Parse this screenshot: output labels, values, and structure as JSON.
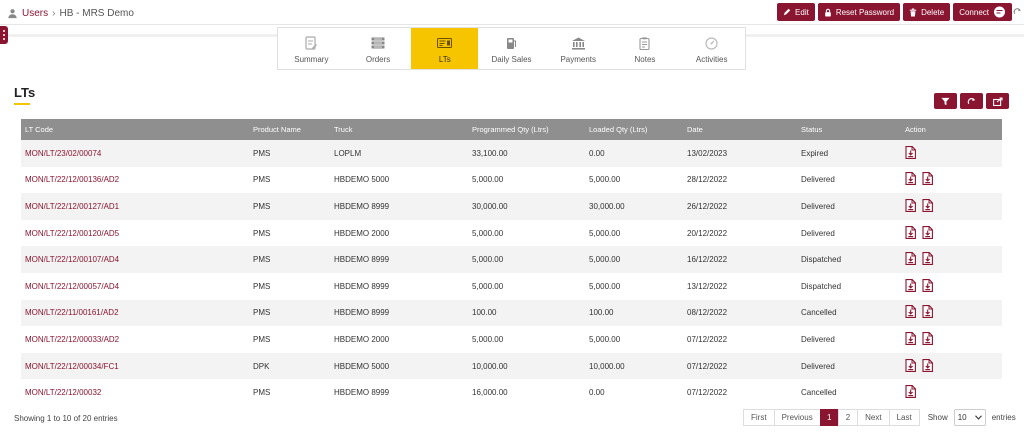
{
  "breadcrumb": {
    "root": "Users",
    "current": "HB - MRS Demo"
  },
  "top_actions": [
    {
      "label": "Edit",
      "icon": "pencil-icon"
    },
    {
      "label": "Reset Password",
      "icon": "lock-icon"
    },
    {
      "label": "Delete",
      "icon": "trash-icon"
    },
    {
      "label": "Connect",
      "icon": "chat-icon"
    }
  ],
  "tabs": [
    {
      "label": "Summary",
      "icon": "summary-icon",
      "active": false
    },
    {
      "label": "Orders",
      "icon": "orders-icon",
      "active": false
    },
    {
      "label": "LTs",
      "icon": "truck-card-icon",
      "active": true
    },
    {
      "label": "Daily Sales",
      "icon": "fuel-pump-icon",
      "active": false
    },
    {
      "label": "Payments",
      "icon": "bank-icon",
      "active": false
    },
    {
      "label": "Notes",
      "icon": "notes-icon",
      "active": false
    },
    {
      "label": "Activities",
      "icon": "dashboard-icon",
      "active": false
    }
  ],
  "section": {
    "title": "LTs"
  },
  "table": {
    "columns": [
      "LT Code",
      "Product Name",
      "Truck",
      "Programmed Qty (Ltrs)",
      "Loaded Qty (Ltrs)",
      "Date",
      "Status",
      "Action"
    ],
    "rows": [
      {
        "code": "MON/LT/23/02/00074",
        "product": "PMS",
        "truck": "LOPLM",
        "programmed": "33,100.00",
        "loaded": "0.00",
        "date": "13/02/2023",
        "status": "Expired",
        "actions": 1
      },
      {
        "code": "MON/LT/22/12/00136/AD2",
        "product": "PMS",
        "truck": "HBDEMO 5000",
        "programmed": "5,000.00",
        "loaded": "5,000.00",
        "date": "28/12/2022",
        "status": "Delivered",
        "actions": 2
      },
      {
        "code": "MON/LT/22/12/00127/AD1",
        "product": "PMS",
        "truck": "HBDEMO 8999",
        "programmed": "30,000.00",
        "loaded": "30,000.00",
        "date": "26/12/2022",
        "status": "Delivered",
        "actions": 2
      },
      {
        "code": "MON/LT/22/12/00120/AD5",
        "product": "PMS",
        "truck": "HBDEMO 2000",
        "programmed": "5,000.00",
        "loaded": "5,000.00",
        "date": "20/12/2022",
        "status": "Delivered",
        "actions": 2
      },
      {
        "code": "MON/LT/22/12/00107/AD4",
        "product": "PMS",
        "truck": "HBDEMO 8999",
        "programmed": "5,000.00",
        "loaded": "5,000.00",
        "date": "16/12/2022",
        "status": "Dispatched",
        "actions": 2
      },
      {
        "code": "MON/LT/22/12/00057/AD4",
        "product": "PMS",
        "truck": "HBDEMO 8999",
        "programmed": "5,000.00",
        "loaded": "5,000.00",
        "date": "13/12/2022",
        "status": "Dispatched",
        "actions": 2
      },
      {
        "code": "MON/LT/22/11/00161/AD2",
        "product": "PMS",
        "truck": "HBDEMO 8999",
        "programmed": "100.00",
        "loaded": "100.00",
        "date": "08/12/2022",
        "status": "Cancelled",
        "actions": 2
      },
      {
        "code": "MON/LT/22/12/00033/AD2",
        "product": "PMS",
        "truck": "HBDEMO 2000",
        "programmed": "5,000.00",
        "loaded": "5,000.00",
        "date": "07/12/2022",
        "status": "Delivered",
        "actions": 2
      },
      {
        "code": "MON/LT/22/12/00034/FC1",
        "product": "DPK",
        "truck": "HBDEMO 5000",
        "programmed": "10,000.00",
        "loaded": "10,000.00",
        "date": "07/12/2022",
        "status": "Delivered",
        "actions": 2
      },
      {
        "code": "MON/LT/22/12/00032",
        "product": "PMS",
        "truck": "HBDEMO 8999",
        "programmed": "16,000.00",
        "loaded": "0.00",
        "date": "07/12/2022",
        "status": "Cancelled",
        "actions": 1
      }
    ]
  },
  "footer": {
    "showing": "Showing 1 to 10 of 20 entries",
    "pagination": {
      "first": "First",
      "previous": "Previous",
      "current_page": "1",
      "next_page": "2",
      "next": "Next",
      "last": "Last"
    },
    "show_label": "Show",
    "page_size": "10",
    "entries_label": "entries"
  },
  "colors": {
    "brand": "#8a1531",
    "active_tab": "#f7c400",
    "table_header": "#8f8f8f"
  }
}
